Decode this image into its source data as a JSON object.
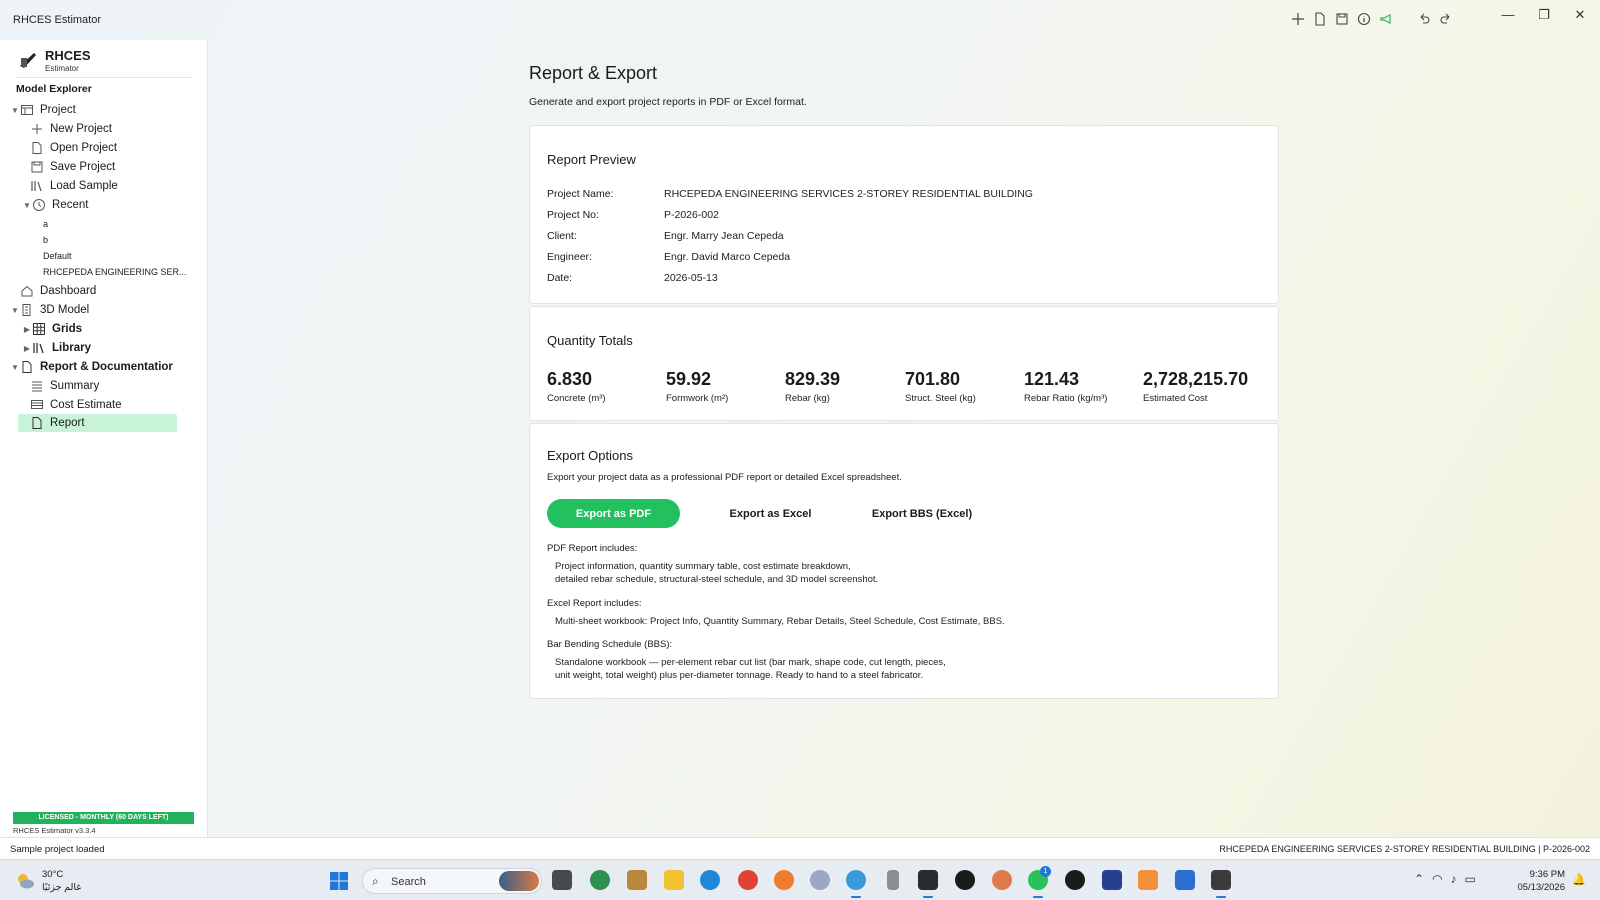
{
  "window": {
    "title": "RHCES Estimator",
    "minimize": "—",
    "maximize": "❐",
    "close": "✕"
  },
  "sidebar": {
    "brand_name": "RHCES",
    "brand_sub": "Estimator",
    "explorer_title": "Model Explorer",
    "project": "Project",
    "new_project": "New Project",
    "open_project": "Open Project",
    "save_project": "Save Project",
    "load_sample": "Load Sample",
    "recent": "Recent",
    "recent_items": [
      "a",
      "b",
      "Default",
      "RHCEPEDA ENGINEERING SER..."
    ],
    "dashboard": "Dashboard",
    "model_3d": "3D Model",
    "grids": "Grids",
    "library": "Library",
    "report_doc": "Report & Documentatior",
    "summary": "Summary",
    "cost_estimate": "Cost Estimate",
    "report": "Report",
    "license": "LICENSED - MONTHLY (60 DAYS LEFT)",
    "version": "RHCES Estimator v3.3.4"
  },
  "main": {
    "title": "Report & Export",
    "subtitle": "Generate and export project reports in PDF or Excel format.",
    "preview": {
      "title": "Report Preview",
      "rows": [
        {
          "label": "Project Name:",
          "value": "RHCEPEDA ENGINEERING SERVICES 2-STOREY RESIDENTIAL BUILDING"
        },
        {
          "label": "Project No:",
          "value": "P-2026-002"
        },
        {
          "label": "Client:",
          "value": "Engr. Marry Jean Cepeda"
        },
        {
          "label": "Engineer:",
          "value": "Engr. David Marco Cepeda"
        },
        {
          "label": "Date:",
          "value": "2026-05-13"
        }
      ]
    },
    "totals": {
      "title": "Quantity Totals",
      "items": [
        {
          "value": "6.830",
          "label": "Concrete (m³)"
        },
        {
          "value": "59.92",
          "label": "Formwork (m²)"
        },
        {
          "value": "829.39",
          "label": "Rebar (kg)"
        },
        {
          "value": "701.80",
          "label": "Struct. Steel (kg)"
        },
        {
          "value": "121.43",
          "label": "Rebar Ratio (kg/m³)"
        },
        {
          "value": "2,728,215.70",
          "label": "Estimated Cost"
        }
      ]
    },
    "export": {
      "title": "Export Options",
      "desc": "Export your project data as a professional PDF report or detailed Excel spreadsheet.",
      "btn_pdf": "Export as PDF",
      "btn_excel": "Export as Excel",
      "btn_bbs": "Export BBS (Excel)",
      "pdf_head": "PDF Report includes:",
      "pdf_line1": "Project information, quantity summary table, cost estimate breakdown,",
      "pdf_line2": "detailed rebar schedule, structural-steel schedule, and 3D model screenshot.",
      "excel_head": "Excel Report includes:",
      "excel_line1": "Multi-sheet workbook: Project Info, Quantity Summary, Rebar Details, Steel Schedule, Cost Estimate, BBS.",
      "bbs_head": "Bar Bending Schedule (BBS):",
      "bbs_line1": "Standalone workbook — per-element rebar cut list (bar mark, shape code, cut length, pieces,",
      "bbs_line2": "unit weight, total weight) plus per-diameter tonnage. Ready to hand to a steel fabricator."
    }
  },
  "statusbar": {
    "left": "Sample project loaded",
    "right": "RHCEPEDA ENGINEERING SERVICES 2-STOREY RESIDENTIAL BUILDING  |  P-2026-002"
  },
  "taskbar": {
    "temp": "30°C",
    "weather_desc": "غالم جزئيًا",
    "search": "Search",
    "time": "9:36 PM",
    "date": "05/13/2026",
    "whatsapp_badge": "1"
  },
  "colors": {
    "accent": "#22c05f",
    "selected": "#c8f3d7",
    "license": "#21b35b"
  }
}
